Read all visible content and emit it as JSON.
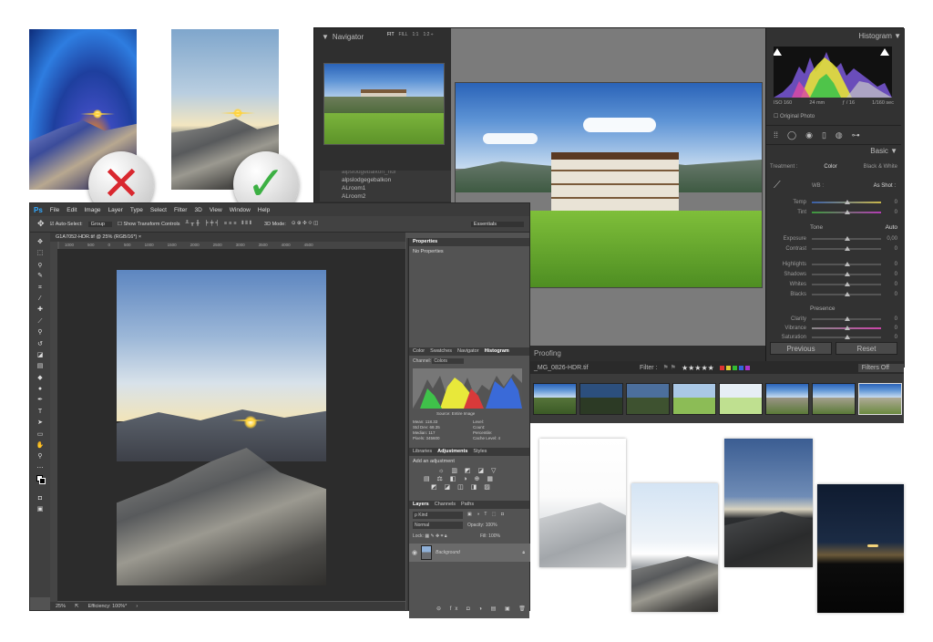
{
  "comparison": {
    "bad_mark": "✕",
    "good_mark": "✓",
    "bad_color": "#d9282f",
    "good_color": "#3cb043"
  },
  "photoshop": {
    "logo": "Ps",
    "menu": [
      "File",
      "Edit",
      "Image",
      "Layer",
      "Type",
      "Select",
      "Filter",
      "3D",
      "View",
      "Window",
      "Help"
    ],
    "options": {
      "auto_select_label": "Auto-Select:",
      "auto_select_value": "Group",
      "transform_label": "Show Transform Controls",
      "mode_3d_label": "3D Mode:",
      "workspace": "Essentials"
    },
    "document_tab": "G1A7052-HDR.tif @ 25% (RGB/16*)",
    "ruler_ticks": [
      "1000",
      "500",
      "0",
      "500",
      "1000",
      "1500",
      "2000",
      "2500",
      "3000",
      "3500",
      "4000",
      "4500"
    ],
    "status": {
      "zoom": "25%",
      "efficiency": "Efficiency: 100%*"
    },
    "properties": {
      "tab": "Properties",
      "empty": "No Properties"
    },
    "panel_tabs_hist": [
      "Color",
      "Swatches",
      "Navigator",
      "Histogram"
    ],
    "histogram": {
      "channel_label": "Channel:",
      "channel": "Colors",
      "source_label": "Source:",
      "source": "Entire Image",
      "stats_left": [
        {
          "k": "Mean:",
          "v": "118.33"
        },
        {
          "k": "Std Dev:",
          "v": "68.35"
        },
        {
          "k": "Median:",
          "v": "117"
        },
        {
          "k": "Pixels:",
          "v": "345600"
        }
      ],
      "stats_right": [
        {
          "k": "Level:",
          "v": ""
        },
        {
          "k": "Count:",
          "v": ""
        },
        {
          "k": "Percentile:",
          "v": ""
        },
        {
          "k": "Cache Level:",
          "v": "4"
        }
      ]
    },
    "panel_tabs_adj": [
      "Libraries",
      "Adjustments",
      "Styles"
    ],
    "adjustments_title": "Add an adjustment",
    "panel_tabs_layers": [
      "Layers",
      "Channels",
      "Paths"
    ],
    "layers": {
      "kind_placeholder": "ρ Kind",
      "blend_mode": "Normal",
      "opacity_label": "Opacity:",
      "opacity": "100%",
      "lock_label": "Lock:",
      "fill_label": "Fill:",
      "fill": "100%",
      "layer_name": "Background"
    }
  },
  "lightroom": {
    "navigator_title": "Navigator",
    "navigator_modes": [
      "FIT",
      "FILL",
      "1:1",
      "1:2 ÷"
    ],
    "folders": [
      "alpslodgegebalkon",
      "ALroom1",
      "ALroom2"
    ],
    "folder_partial": "alpslodgebalkon_hdr",
    "proofing": "Proofing",
    "histogram_title": "Histogram",
    "exif": [
      "ISO 160",
      "24 mm",
      "ƒ / 16",
      "1/160 sec"
    ],
    "original_photo": "Original Photo",
    "basic_title": "Basic",
    "treatment_label": "Treatment :",
    "treatment_color": "Color",
    "treatment_bw": "Black & White",
    "wb_label": "WB :",
    "wb_value": "As Shot :",
    "temp": {
      "label": "Temp",
      "value": "0"
    },
    "tint": {
      "label": "Tint",
      "value": "0"
    },
    "tone_label": "Tone",
    "auto_label": "Auto",
    "exposure": {
      "label": "Exposure",
      "value": "0,00"
    },
    "contrast": {
      "label": "Contrast",
      "value": "0"
    },
    "highlights": {
      "label": "Highlights",
      "value": "0"
    },
    "shadows": {
      "label": "Shadows",
      "value": "0"
    },
    "whites": {
      "label": "Whites",
      "value": "0"
    },
    "blacks": {
      "label": "Blacks",
      "value": "0"
    },
    "presence_label": "Presence",
    "clarity": {
      "label": "Clarity",
      "value": "0"
    },
    "vibrance": {
      "label": "Vibrance",
      "value": "0"
    },
    "saturation": {
      "label": "Saturation",
      "value": "0"
    },
    "previous_button": "Previous",
    "reset_button": "Reset",
    "filename": "_MG_0826-HDR.tif",
    "filter_label": "Filter :",
    "stars": "★★★★★",
    "filters_off": "Filters Off"
  },
  "colors": {
    "ps_accent": "#31a8ff",
    "lr_bg": "#2c2c2c"
  }
}
